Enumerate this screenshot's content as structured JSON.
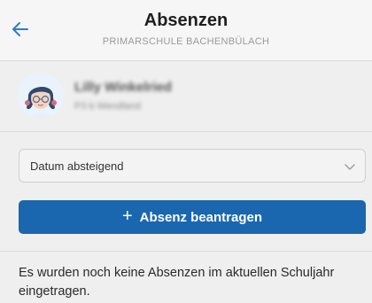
{
  "header": {
    "title": "Absenzen",
    "subtitle": "PRIMARSCHULE BACHENBÜLACH"
  },
  "profile": {
    "name": "Lilly Winkelried",
    "class": "P3 b Wendland"
  },
  "sort": {
    "selected": "Datum absteigend"
  },
  "actions": {
    "request_label": "Absenz beantragen"
  },
  "empty_state": {
    "message": "Es wurden noch keine Absenzen im aktuellen Schuljahr eingetragen."
  },
  "colors": {
    "accent": "#1a67b0",
    "back_arrow": "#2a7dd3",
    "background": "#efefef"
  },
  "icons": {
    "back": "arrow-left-icon",
    "select": "chevron-down-icon",
    "add": "plus-icon",
    "avatar": "girl-avatar-icon"
  }
}
